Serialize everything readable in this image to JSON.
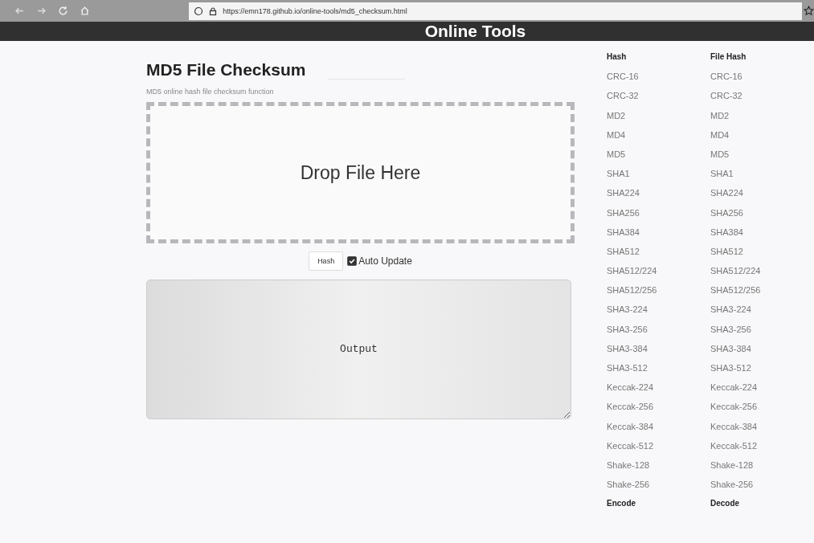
{
  "browser": {
    "url": "https://emn178.github.io/online-tools/md5_checksum.html"
  },
  "header": {
    "title": "Online Tools"
  },
  "main": {
    "title": "MD5 File Checksum",
    "subtitle": "MD5 online hash file checksum function",
    "drop_zone": "Drop File Here",
    "hash_button": "Hash",
    "auto_update": {
      "label": "Auto Update",
      "checked": true
    },
    "output": {
      "placeholder": "Output"
    }
  },
  "sidebar": {
    "columns": [
      {
        "heading": "Hash",
        "items": [
          "CRC-16",
          "CRC-32",
          "MD2",
          "MD4",
          "MD5",
          "SHA1",
          "SHA224",
          "SHA256",
          "SHA384",
          "SHA512",
          "SHA512/224",
          "SHA512/256",
          "SHA3-224",
          "SHA3-256",
          "SHA3-384",
          "SHA3-512",
          "Keccak-224",
          "Keccak-256",
          "Keccak-384",
          "Keccak-512",
          "Shake-128",
          "Shake-256"
        ],
        "footer_heading": "Encode"
      },
      {
        "heading": "File Hash",
        "items": [
          "CRC-16",
          "CRC-32",
          "MD2",
          "MD4",
          "MD5",
          "SHA1",
          "SHA224",
          "SHA256",
          "SHA384",
          "SHA512",
          "SHA512/224",
          "SHA512/256",
          "SHA3-224",
          "SHA3-256",
          "SHA3-384",
          "SHA3-512",
          "Keccak-224",
          "Keccak-256",
          "Keccak-384",
          "Keccak-512",
          "Shake-128",
          "Shake-256"
        ],
        "footer_heading": "Decode"
      }
    ]
  }
}
